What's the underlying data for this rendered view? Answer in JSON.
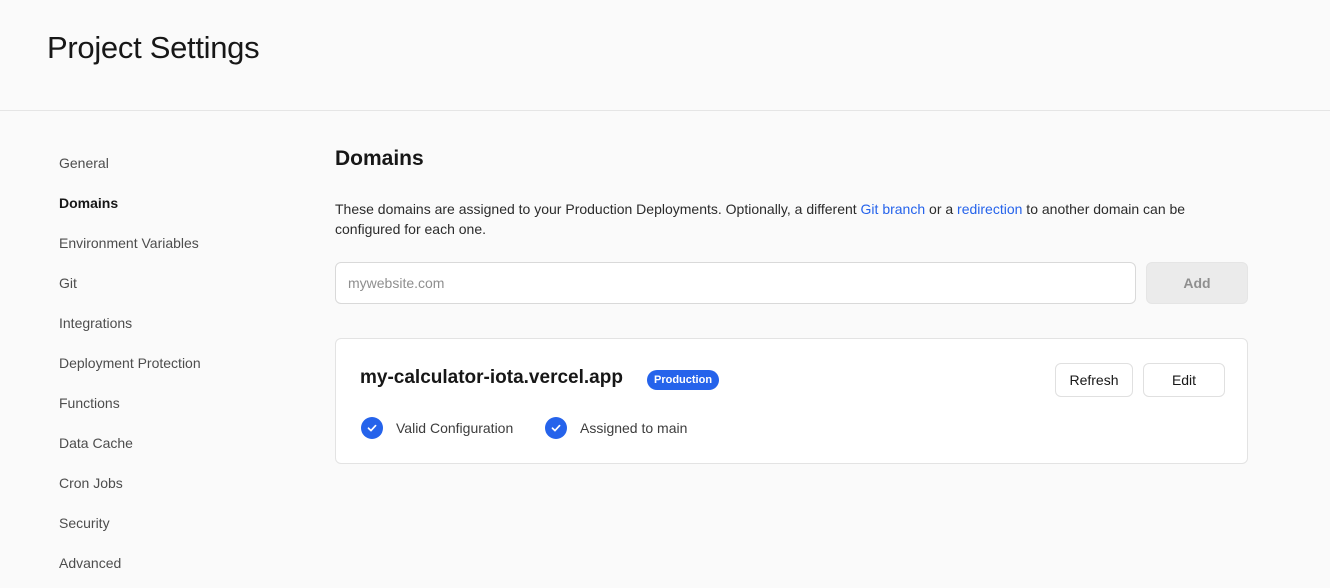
{
  "header": {
    "title": "Project Settings"
  },
  "sidebar": {
    "items": [
      {
        "label": "General"
      },
      {
        "label": "Domains",
        "active": true
      },
      {
        "label": "Environment Variables"
      },
      {
        "label": "Git"
      },
      {
        "label": "Integrations"
      },
      {
        "label": "Deployment Protection"
      },
      {
        "label": "Functions"
      },
      {
        "label": "Data Cache"
      },
      {
        "label": "Cron Jobs"
      },
      {
        "label": "Security"
      },
      {
        "label": "Advanced"
      }
    ]
  },
  "main": {
    "title": "Domains",
    "description": {
      "part1": "These domains are assigned to your Production Deployments. Optionally, a different ",
      "link1": "Git branch",
      "part2": " or a ",
      "link2": "redirection",
      "part3": " to another domain can be configured for each one."
    },
    "input": {
      "placeholder": "mywebsite.com",
      "value": ""
    },
    "add_label": "Add",
    "domain": {
      "name": "my-calculator-iota.vercel.app",
      "badge": "Production",
      "refresh_label": "Refresh",
      "edit_label": "Edit",
      "statuses": [
        {
          "label": "Valid Configuration",
          "icon": "check-circle-icon"
        },
        {
          "label": "Assigned to main",
          "icon": "check-circle-icon"
        }
      ]
    }
  },
  "colors": {
    "accent": "#2563eb",
    "background": "#fafafa",
    "card": "#ffffff",
    "border": "#e5e5e5"
  }
}
